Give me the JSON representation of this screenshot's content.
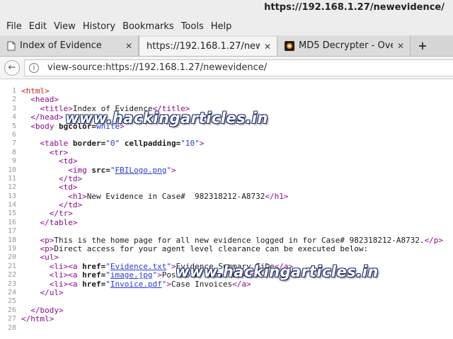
{
  "window": {
    "title": "https://192.168.1.27/newevidence/"
  },
  "menu": [
    "File",
    "Edit",
    "View",
    "History",
    "Bookmarks",
    "Tools",
    "Help"
  ],
  "tabs": [
    {
      "label": "Index of Evidence",
      "icon": "page-icon",
      "active": false
    },
    {
      "label": "https://192.168.1.27/new...",
      "icon": "",
      "active": true
    },
    {
      "label": "MD5 Decrypter - Ove...",
      "icon": "md5-site-icon",
      "active": false
    }
  ],
  "newtab_label": "+",
  "urlbar": {
    "url": "view-source:https://192.168.1.27/newevidence/"
  },
  "watermark": "www.hackingarticles.in",
  "source": {
    "line_numbers": [
      "1",
      "2",
      "3",
      "4",
      "5",
      "6",
      "7",
      "8",
      "9",
      "10",
      "11",
      "12",
      "13",
      "14",
      "15",
      "16",
      "17",
      "18",
      "19",
      "20",
      "21",
      "22",
      "23",
      "24",
      "25",
      "26",
      "27",
      "28"
    ],
    "l1": "<html>",
    "l2": "<head>",
    "l3_open": "<title>",
    "l3_text": "Index of Evidence",
    "l3_close": "</title>",
    "l4": "</head>",
    "l5_tag": "<body",
    "l5_attr": " bgcolor=",
    "l5_val": "white",
    "l5_end": ">",
    "l7_tag": "<table",
    "l7_attr1": " border=",
    "l7_val1": "\"0\"",
    "l7_attr2": " cellpadding=",
    "l7_val2": "\"10\"",
    "l7_end": ">",
    "l8": "<tr>",
    "l9": "<td>",
    "l10_tag": "<img",
    "l10_attr": " src=",
    "l10_q1": "\"",
    "l10_link": "FBILogo.png",
    "l10_q2": "\"",
    "l10_end": ">",
    "l11": "</td>",
    "l12": "<td>",
    "l13_open": "<h1>",
    "l13_text": "New Evidence in Case#  982318212-A8732",
    "l13_close": "</h1>",
    "l14": "</td>",
    "l15": "</tr>",
    "l16": "</table>",
    "l18_open": "<p>",
    "l18_text": "This is the home page for all new evidence logged in for Case# 982318212-A8732.",
    "l18_close": "</p>",
    "l19_open": "<p>",
    "l19_text": "Direct access for your agent level clearance can be executed below:",
    "l20": "<ul>",
    "l21_li": "<li>",
    "l21_a": "<a",
    "l21_attr": " href=",
    "l21_q1": "\"",
    "l21_link": "Evidence.txt",
    "l21_q2": "\"",
    "l21_gt": ">",
    "l21_text": "Evidence Summary File",
    "l21_close": "</a>",
    "l22_li": "<li>",
    "l22_a": "<a",
    "l22_attr": " href=",
    "l22_q1": "\"",
    "l22_link": "image.jpg",
    "l22_q2": "\"",
    "l22_gt": ">",
    "l22_text": "Possible Location",
    "l22_close": "</a>",
    "l23_li": "<li>",
    "l23_a": "<a",
    "l23_attr": " href=",
    "l23_q1": "\"",
    "l23_link": "Invoice.pdf",
    "l23_q2": "\"",
    "l23_gt": ">",
    "l23_text": "Case Invoices",
    "l23_close": "</a>",
    "l24": "</ul>",
    "l26": "</body>",
    "l27": "</html>"
  }
}
